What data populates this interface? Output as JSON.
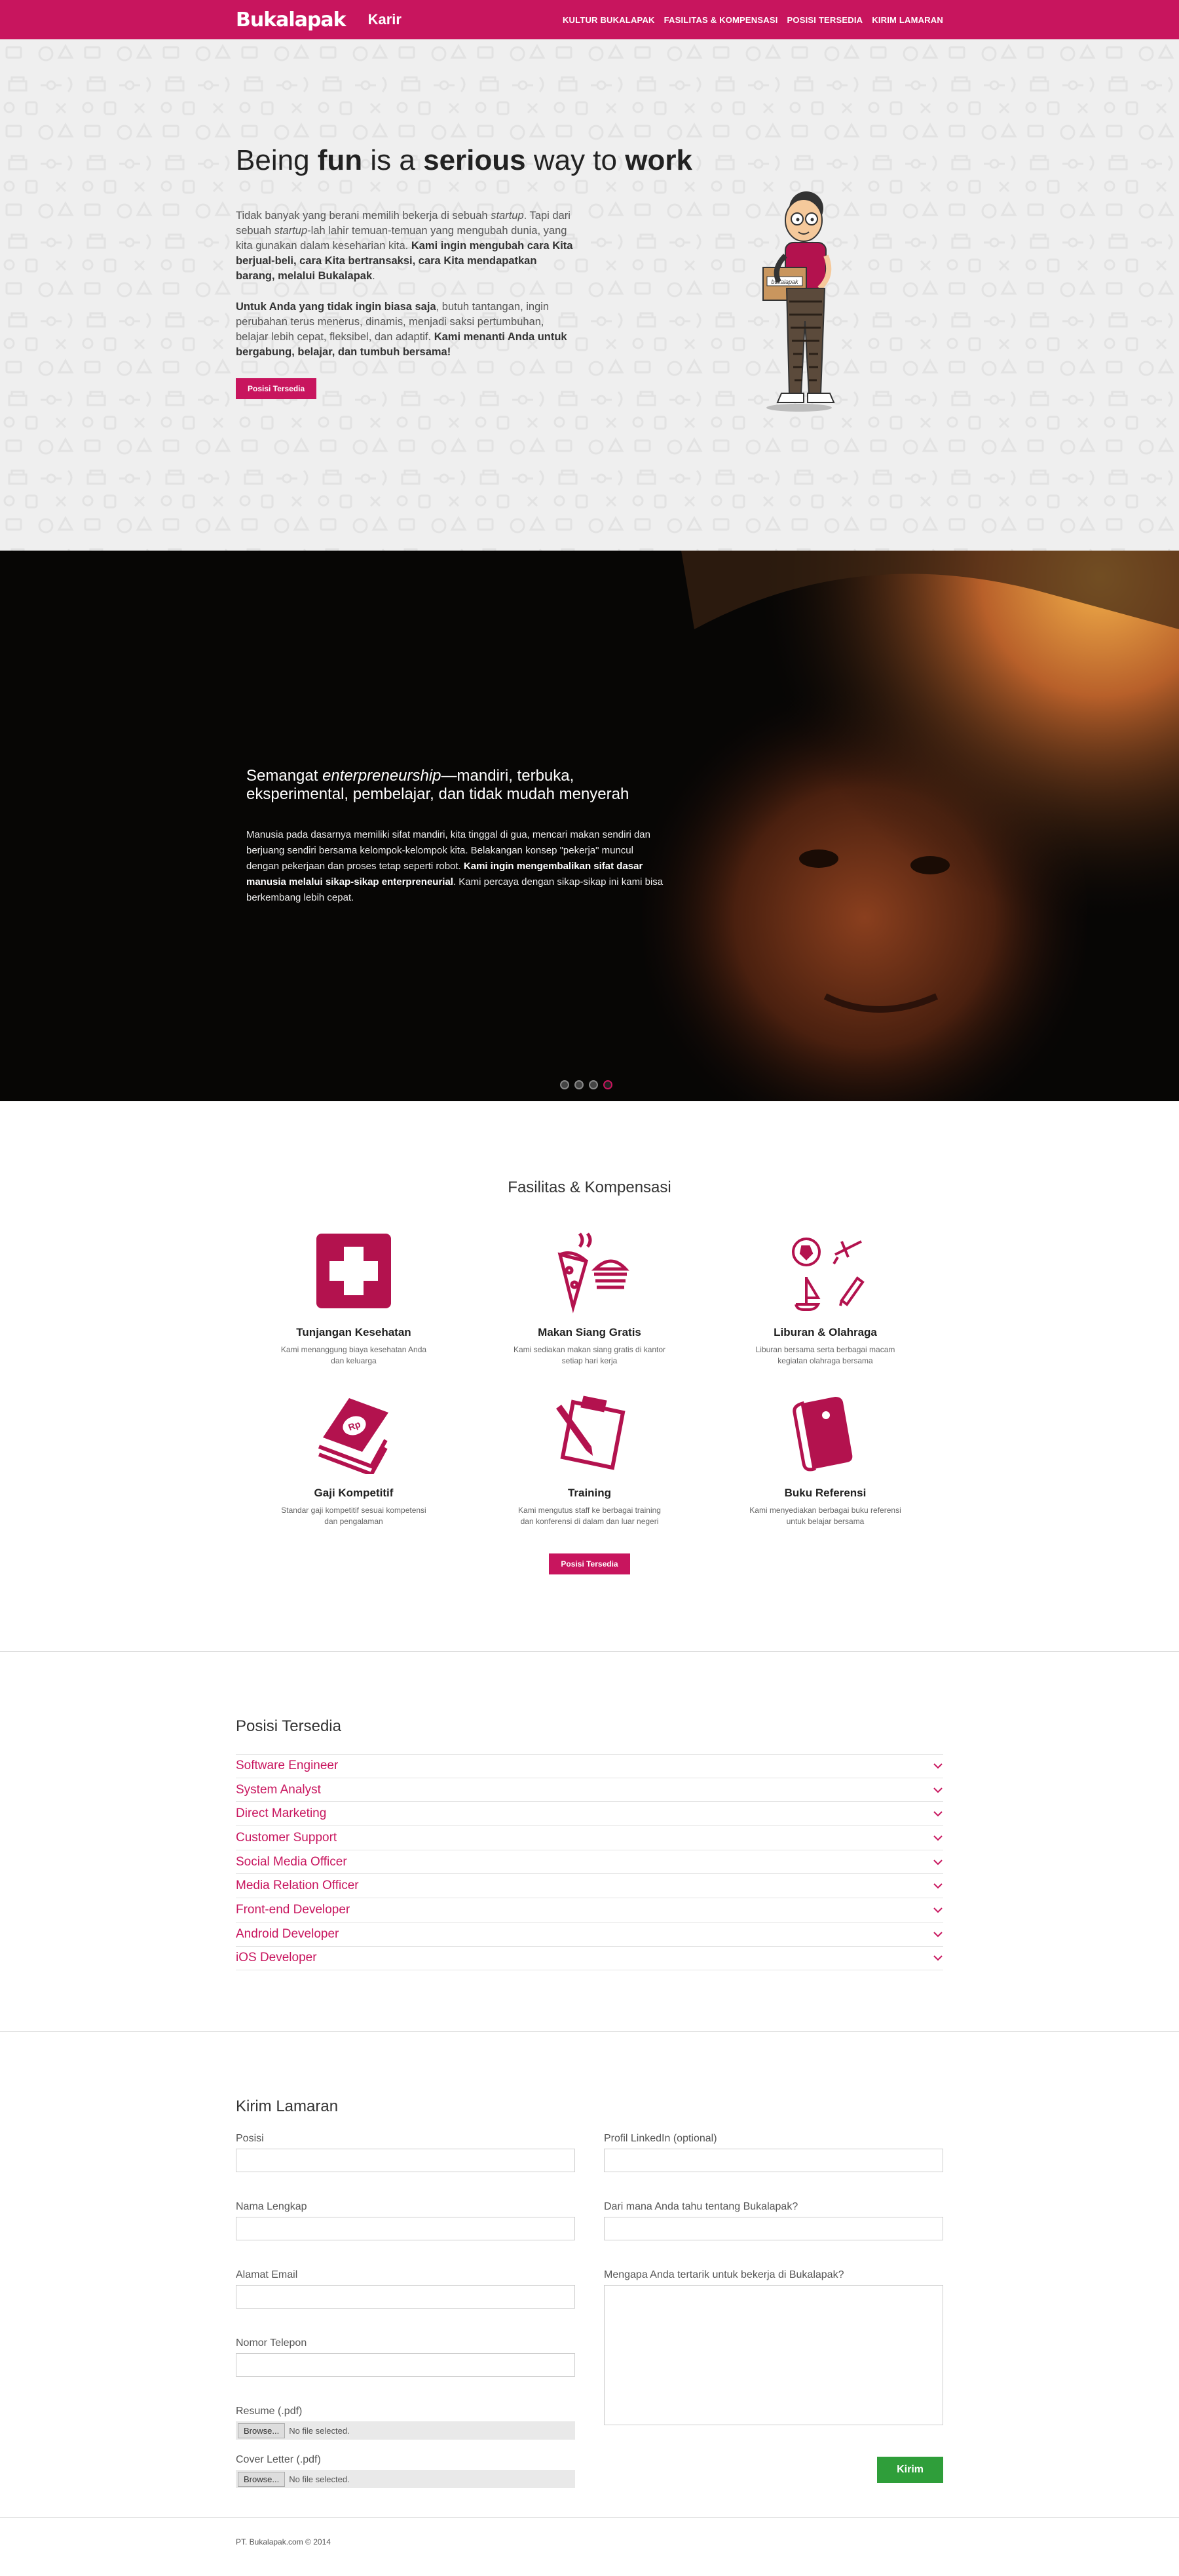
{
  "nav": {
    "logo": "Bukalapak",
    "subtitle": "Karir",
    "links": [
      "KULTUR BUKALAPAK",
      "FASILITAS & KOMPENSASI",
      "POSISI TERSEDIA",
      "KIRIM LAMARAN"
    ]
  },
  "hero": {
    "title_1": "Being ",
    "title_fun": "fun",
    "title_2": " is a ",
    "title_serious": "serious",
    "title_3": " way to ",
    "title_work": "work",
    "p1_a": "Tidak banyak yang berani memilih bekerja di sebuah ",
    "p1_startup": "startup",
    "p1_b": ". Tapi dari sebuah ",
    "p1_startup2": "startup",
    "p1_c": "-lah lahir temuan-temuan yang mengubah dunia, yang kita gunakan dalam keseharian kita. ",
    "p1_bold": "Kami ingin mengubah cara Kita berjual-beli, cara Kita bertransaksi, cara Kita mendapatkan barang, melalui Bukalapak",
    "p1_end": ".",
    "p2_bold": "Untuk Anda yang tidak ingin biasa saja",
    "p2_a": ", butuh tantangan, ingin perubahan terus menerus, dinamis, menjadi saksi pertumbuhan, belajar lebih cepat, fleksibel, dan adaptif. ",
    "p2_bold2": "Kami menanti Anda untuk bergabung, belajar, dan tumbuh bersama!",
    "button": "Posisi Tersedia",
    "mascot_box_label": "bukalapak"
  },
  "slider": {
    "title_a": "Semangat ",
    "title_em": "enterpreneurship",
    "title_b": "—mandiri, terbuka, eksperimental, pembelajar, dan tidak mudah menyerah",
    "body_a": "Manusia pada dasarnya memiliki sifat mandiri, kita tinggal di gua, mencari makan sendiri dan berjuang sendiri bersama kelompok-kelompok kita. Belakangan konsep \"pekerja\" muncul dengan pekerjaan dan proses tetap seperti robot. ",
    "body_bold": "Kami ingin mengembalikan sifat dasar manusia melalui sikap-sikap enterpreneurial",
    "body_b": ". Kami percaya dengan sikap-sikap ini kami bisa berkembang lebih cepat.",
    "active_dot": 4
  },
  "facilities": {
    "title": "Fasilitas & Kompensasi",
    "items": [
      {
        "name": "Tunjangan Kesehatan",
        "desc": "Kami menanggung biaya kesehatan Anda dan keluarga",
        "icon": "health-cross-icon"
      },
      {
        "name": "Makan Siang Gratis",
        "desc": "Kami sediakan makan siang gratis di kantor setiap hari kerja",
        "icon": "food-icon"
      },
      {
        "name": "Liburan & Olahraga",
        "desc": "Liburan bersama serta berbagai macam kegiatan olahraga bersama",
        "icon": "holiday-sport-icon"
      },
      {
        "name": "Gaji Kompetitif",
        "desc": "Standar gaji kompetitif sesuai kompetensi dan pengalaman",
        "icon": "money-icon"
      },
      {
        "name": "Training",
        "desc": "Kami mengutus staff ke berbagai training dan konferensi di dalam dan luar negeri",
        "icon": "clipboard-icon"
      },
      {
        "name": "Buku Referensi",
        "desc": "Kami menyediakan berbagai buku referensi untuk belajar bersama",
        "icon": "book-icon"
      }
    ],
    "money_label": "Rp",
    "button": "Posisi Tersedia"
  },
  "positions": {
    "title": "Posisi Tersedia",
    "items": [
      "Software Engineer",
      "System Analyst",
      "Direct Marketing",
      "Customer Support",
      "Social Media Officer",
      "Media Relation Officer",
      "Front-end Developer",
      "Android Developer",
      "iOS Developer"
    ]
  },
  "form": {
    "title": "Kirim Lamaran",
    "posisi": "Posisi",
    "nama": "Nama Lengkap",
    "email": "Alamat Email",
    "telepon": "Nomor Telepon",
    "resume": "Resume (.pdf)",
    "cover": "Cover Letter (.pdf)",
    "browse": "Browse...",
    "no_file": "No file selected.",
    "linkedin": "Profil LinkedIn (optional)",
    "source": "Dari mana Anda tahu tentang Bukalapak?",
    "reason": "Mengapa Anda tertarik untuk bekerja di Bukalapak?",
    "submit": "Kirim"
  },
  "footer": {
    "text": "PT. Bukalapak.com © 2014"
  },
  "colors": {
    "brand": "#c8155e",
    "submit": "#2f9e3a"
  }
}
